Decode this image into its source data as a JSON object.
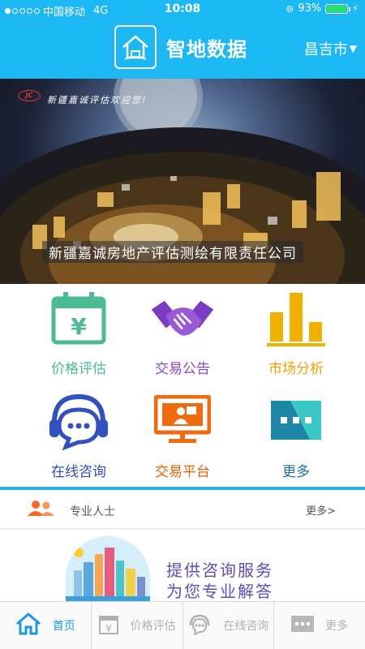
{
  "status_bar": {
    "carrier": "中国移动",
    "network": "4G",
    "time": "10:08",
    "battery": "93%",
    "battery_level": 0.93
  },
  "header": {
    "app_title": "智地数据",
    "city": "昌吉市"
  },
  "banner": {
    "welcome": "新疆嘉诚评估欢迎您!",
    "logo_text": "JC",
    "company": "新疆嘉诚房地产评估测绘有限责任公司"
  },
  "grid": {
    "items": [
      {
        "label": "价格评估",
        "icon": "calendar-yen-icon",
        "color": "#4cbb8f"
      },
      {
        "label": "交易公告",
        "icon": "handshake-icon",
        "color": "#8a47c8"
      },
      {
        "label": "市场分析",
        "icon": "bar-chart-icon",
        "color": "#f0b000"
      },
      {
        "label": "在线咨询",
        "icon": "headset-chat-icon",
        "color": "#3350c0"
      },
      {
        "label": "交易平台",
        "icon": "monitor-presenter-icon",
        "color": "#f06a10"
      },
      {
        "label": "更多",
        "icon": "more-dots-icon",
        "color": "#1e86a6"
      }
    ]
  },
  "professionals": {
    "title": "专业人士",
    "more": "更多>"
  },
  "promo": {
    "line1": "提供咨询服务",
    "line2": "为您专业解答"
  },
  "tabbar": {
    "tabs": [
      {
        "label": "首页",
        "icon": "home-icon",
        "active": true
      },
      {
        "label": "价格评估",
        "icon": "calendar-yen-icon",
        "active": false
      },
      {
        "label": "在线咨询",
        "icon": "chat-icon",
        "active": false
      },
      {
        "label": "更多",
        "icon": "more-dots-icon",
        "active": false
      }
    ]
  },
  "colors": {
    "primary": "#1cb8f3",
    "tab_active": "#1a9be0",
    "tab_inactive": "#b0b0b0"
  }
}
